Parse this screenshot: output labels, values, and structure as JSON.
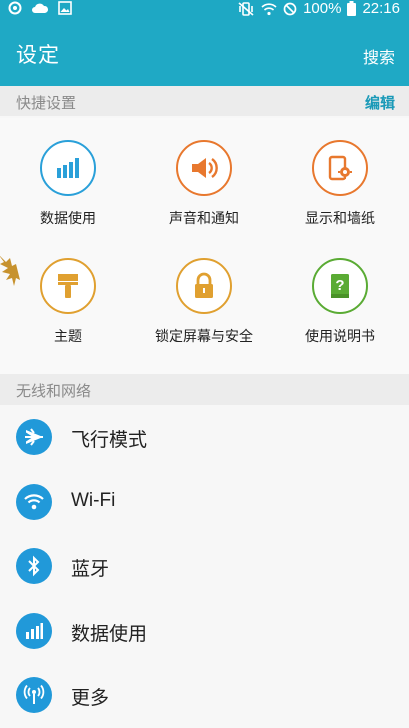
{
  "status_bar": {
    "battery_percent": "100%",
    "time": "22:16"
  },
  "header": {
    "title": "设定",
    "search_label": "搜索"
  },
  "quick_settings": {
    "title": "快捷设置",
    "edit_label": "编辑",
    "items": [
      {
        "label": "数据使用",
        "icon": "data-usage-icon",
        "color": "#2aa0d9"
      },
      {
        "label": "声音和通知",
        "icon": "speaker-icon",
        "color": "#e8782e"
      },
      {
        "label": "显示和墙纸",
        "icon": "display-wallpaper-icon",
        "color": "#e8782e"
      },
      {
        "label": "主题",
        "icon": "paintbrush-icon",
        "color": "#e0a030"
      },
      {
        "label": "锁定屏幕与安全",
        "icon": "lock-icon",
        "color": "#e0a030"
      },
      {
        "label": "使用说明书",
        "icon": "manual-book-icon",
        "color": "#5aab34"
      }
    ]
  },
  "network": {
    "title": "无线和网络",
    "items": [
      {
        "label": "飞行模式",
        "icon": "airplane-icon"
      },
      {
        "label": "Wi-Fi",
        "icon": "wifi-icon"
      },
      {
        "label": "蓝牙",
        "icon": "bluetooth-icon"
      },
      {
        "label": "数据使用",
        "icon": "data-usage-icon"
      },
      {
        "label": "更多",
        "icon": "antenna-icon"
      }
    ]
  },
  "colors": {
    "accent": "#1fa9c5",
    "list_icon_bg": "#2199d9"
  }
}
